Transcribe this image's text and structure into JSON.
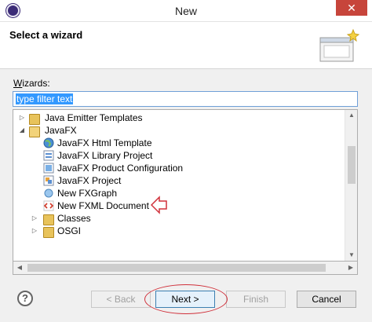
{
  "window": {
    "title": "New",
    "close_glyph": "✕"
  },
  "header": {
    "title": "Select a wizard"
  },
  "wizards": {
    "label_prefix": "W",
    "label_rest": "izards:",
    "filter_placeholder": "type filter text"
  },
  "tree": {
    "items": [
      {
        "label": "Java Emitter Templates",
        "icon": "folder-icon",
        "expanded": false
      },
      {
        "label": "JavaFX",
        "icon": "folder-open-icon",
        "expanded": true
      },
      {
        "label": "JavaFX Html Template",
        "icon": "globe-icon"
      },
      {
        "label": "JavaFX Library Project",
        "icon": "library-project-icon"
      },
      {
        "label": "JavaFX Product Configuration",
        "icon": "product-config-icon"
      },
      {
        "label": "JavaFX Project",
        "icon": "project-icon"
      },
      {
        "label": "New FXGraph",
        "icon": "fxgraph-icon"
      },
      {
        "label": "New FXML Document",
        "icon": "fxml-icon"
      },
      {
        "label": "Classes",
        "icon": "folder-icon",
        "expanded": false
      },
      {
        "label": "OSGI",
        "icon": "folder-icon",
        "expanded": false
      }
    ]
  },
  "buttons": {
    "help": "?",
    "back": "< Back",
    "next": "Next >",
    "finish": "Finish",
    "cancel": "Cancel"
  },
  "colors": {
    "annotation": "#d0303a",
    "selection": "#3399ff",
    "close": "#c7453b"
  }
}
